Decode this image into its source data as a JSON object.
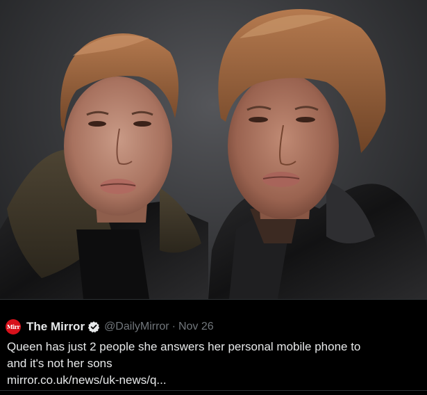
{
  "tweet": {
    "avatar_text": "Mirr",
    "display_name": "The Mirror",
    "verified_icon": "verified-badge-icon",
    "handle": "@DailyMirror",
    "separator": "·",
    "date": "Nov 26",
    "text_line_1": "Queen has just 2 people she answers her personal mobile phone to",
    "text_line_2": "and it's not her sons",
    "link": "mirror.co.uk/news/uk-news/q..."
  },
  "colors": {
    "background": "#000000",
    "text": "#e7e9ea",
    "muted": "#71767b",
    "avatar_red": "#d8111b",
    "divider": "#2f3336"
  }
}
